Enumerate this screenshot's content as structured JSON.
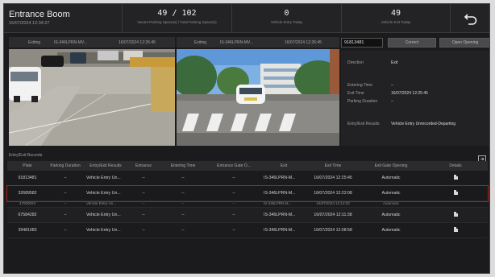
{
  "header": {
    "title": "Entrance Boom",
    "datetime": "16/07/2024 12:34:27",
    "stats": [
      {
        "value": "49 / 102",
        "label": "Vacant Parking Space(s) / Total Parking Space(s)"
      },
      {
        "value": "0",
        "label": "Vehicle Entry Today"
      },
      {
        "value": "49",
        "label": "Vehicle Exit Today"
      }
    ]
  },
  "cameras": {
    "left": {
      "label": "Exiting",
      "camera": "IS-346LPRN-MV...",
      "time": "16/07/2024 12:26:45"
    },
    "right": {
      "label": "Exiting",
      "camera": "IS-346LPRN-MV...",
      "time": "16/07/2024 12:26:45"
    }
  },
  "panel": {
    "plate_value": "91813481",
    "correct_label": "Correct",
    "open_label": "Open Opening",
    "rows": [
      {
        "label": "Direction",
        "value": "Exit"
      },
      {
        "label": "Entering Time",
        "value": "--"
      },
      {
        "label": "Exit Time",
        "value": "16/07/2024 12:25:45"
      },
      {
        "label": "Parking Duration",
        "value": "--"
      },
      {
        "label": "Entry/Exit Results",
        "value": "Vehicle Entry Unrecorded-Departing"
      }
    ]
  },
  "records": {
    "title": "Entry/Exit Records",
    "columns": [
      "Plate",
      "Parking Duration",
      "Entry/Exit Results",
      "Entrance",
      "Entering Time",
      "Entrance Gate O...",
      "Exit",
      "Exit Time",
      "Exit Gate Opening",
      "Details"
    ],
    "rows": [
      [
        "91813481",
        "--",
        "Vehicle Entry Un...",
        "--",
        "--",
        "--",
        "IS-346LPRN-M...",
        "16/07/2024 12:25:45",
        "Automatic"
      ],
      [
        "32689582",
        "--",
        "Vehicle Entry Un...",
        "--",
        "--",
        "--",
        "IS-346LPRN-M...",
        "16/07/2024 12:22:08",
        "Automatic"
      ],
      [
        "67584282",
        "--",
        "Vehicle Entry Un...",
        "--",
        "--",
        "--",
        "IS-346LPRN-M...",
        "16/07/2024 12:11:38",
        "Automatic"
      ],
      [
        "39481083",
        "--",
        "Vehicle Entry Un...",
        "--",
        "--",
        "--",
        "IS-346LPRN-M...",
        "16/07/2024 12:08:58",
        "Automatic"
      ]
    ],
    "partial_row": [
      "47000023",
      "--",
      "Vehicle Entry Un...",
      "--",
      "--",
      "--",
      "IS-346LPRN-M...",
      "16/07/2024 12:14:03",
      "Automatic"
    ]
  }
}
